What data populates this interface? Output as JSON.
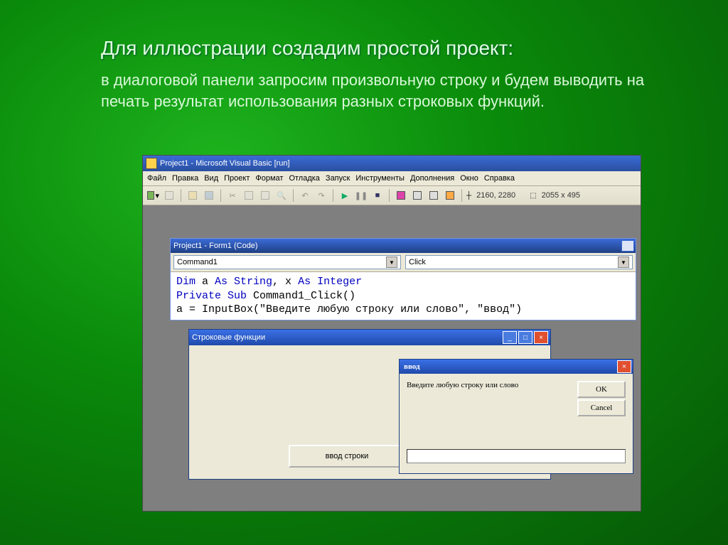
{
  "slide": {
    "title": "Для иллюстрации создадим простой проект:",
    "subtitle": "в диалоговой панели запросим произвольную строку и будем выводить на печать результат использования разных строковых функций."
  },
  "main_window": {
    "title": "Project1 - Microsoft Visual Basic [run]",
    "menu": [
      "Файл",
      "Правка",
      "Вид",
      "Проект",
      "Формат",
      "Отладка",
      "Запуск",
      "Инструменты",
      "Дополнения",
      "Окно",
      "Справка"
    ],
    "coords1": "2160, 2280",
    "coords2": "2055 x 495"
  },
  "code_window": {
    "title": "Project1 - Form1 (Code)",
    "combo_left": "Command1",
    "combo_right": "Click",
    "line1_pre": "Dim",
    "line1_mid": " a ",
    "line1_as": "As String",
    "line1_mid2": ", x ",
    "line1_end": "As Integer",
    "line2_a": "Private Sub",
    "line2_b": " Command1_Click()",
    "line3_pre": "a = InputBox(",
    "line3_str": "\"Введите любую строку или слово\", \"ввод\"",
    "line3_post": ")"
  },
  "form_window": {
    "title": "Строковые функции",
    "button_label": "ввод строки"
  },
  "inputbox": {
    "title": "ввод",
    "prompt": "Введите любую строку или слово",
    "ok": "OK",
    "cancel": "Cancel"
  }
}
